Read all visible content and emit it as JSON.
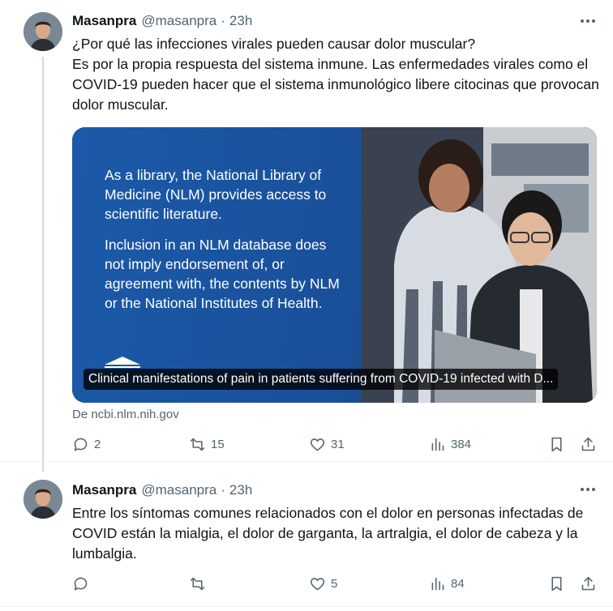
{
  "tweets": [
    {
      "author": {
        "name": "Masanpra",
        "handle": "@masanpra",
        "time": "23h"
      },
      "text": [
        "¿Por qué las infecciones virales pueden causar dolor muscular?",
        "Es por la propia respuesta del sistema inmune. Las enfermedades virales como el COVID-19 pueden hacer que el sistema inmunológico libere citocinas que provocan dolor muscular."
      ],
      "card": {
        "image_text": [
          "As a library, the National Library of Medicine (NLM) provides access to scientific literature.",
          "Inclusion in an NLM database does not imply endorsement of, or agreement with, the contents by NLM or the National Institutes of Health."
        ],
        "logo_text": "PMC PubMed Central®",
        "caption": "Clinical manifestations of pain in patients suffering from COVID-19 infected with D...",
        "source": "De ncbi.nlm.nih.gov"
      },
      "stats": {
        "replies": "2",
        "reposts": "15",
        "likes": "31",
        "views": "384"
      }
    },
    {
      "author": {
        "name": "Masanpra",
        "handle": "@masanpra",
        "time": "23h"
      },
      "text": [
        "Entre los síntomas comunes relacionados con el dolor en personas infectadas de COVID están la mialgia, el dolor de garganta, la artralgia, el dolor de cabeza y la lumbalgia."
      ],
      "stats": {
        "replies": "",
        "reposts": "",
        "likes": "5",
        "views": "84"
      }
    }
  ],
  "icons": [
    "reply-icon",
    "repost-icon",
    "like-icon",
    "views-icon",
    "bookmark-icon",
    "share-icon",
    "more-icon"
  ],
  "colors": {
    "secondary_text": "#536471",
    "primary_text": "#0f1419",
    "card_blue": "#1d4f9a",
    "thread_line": "#cfd9de"
  }
}
